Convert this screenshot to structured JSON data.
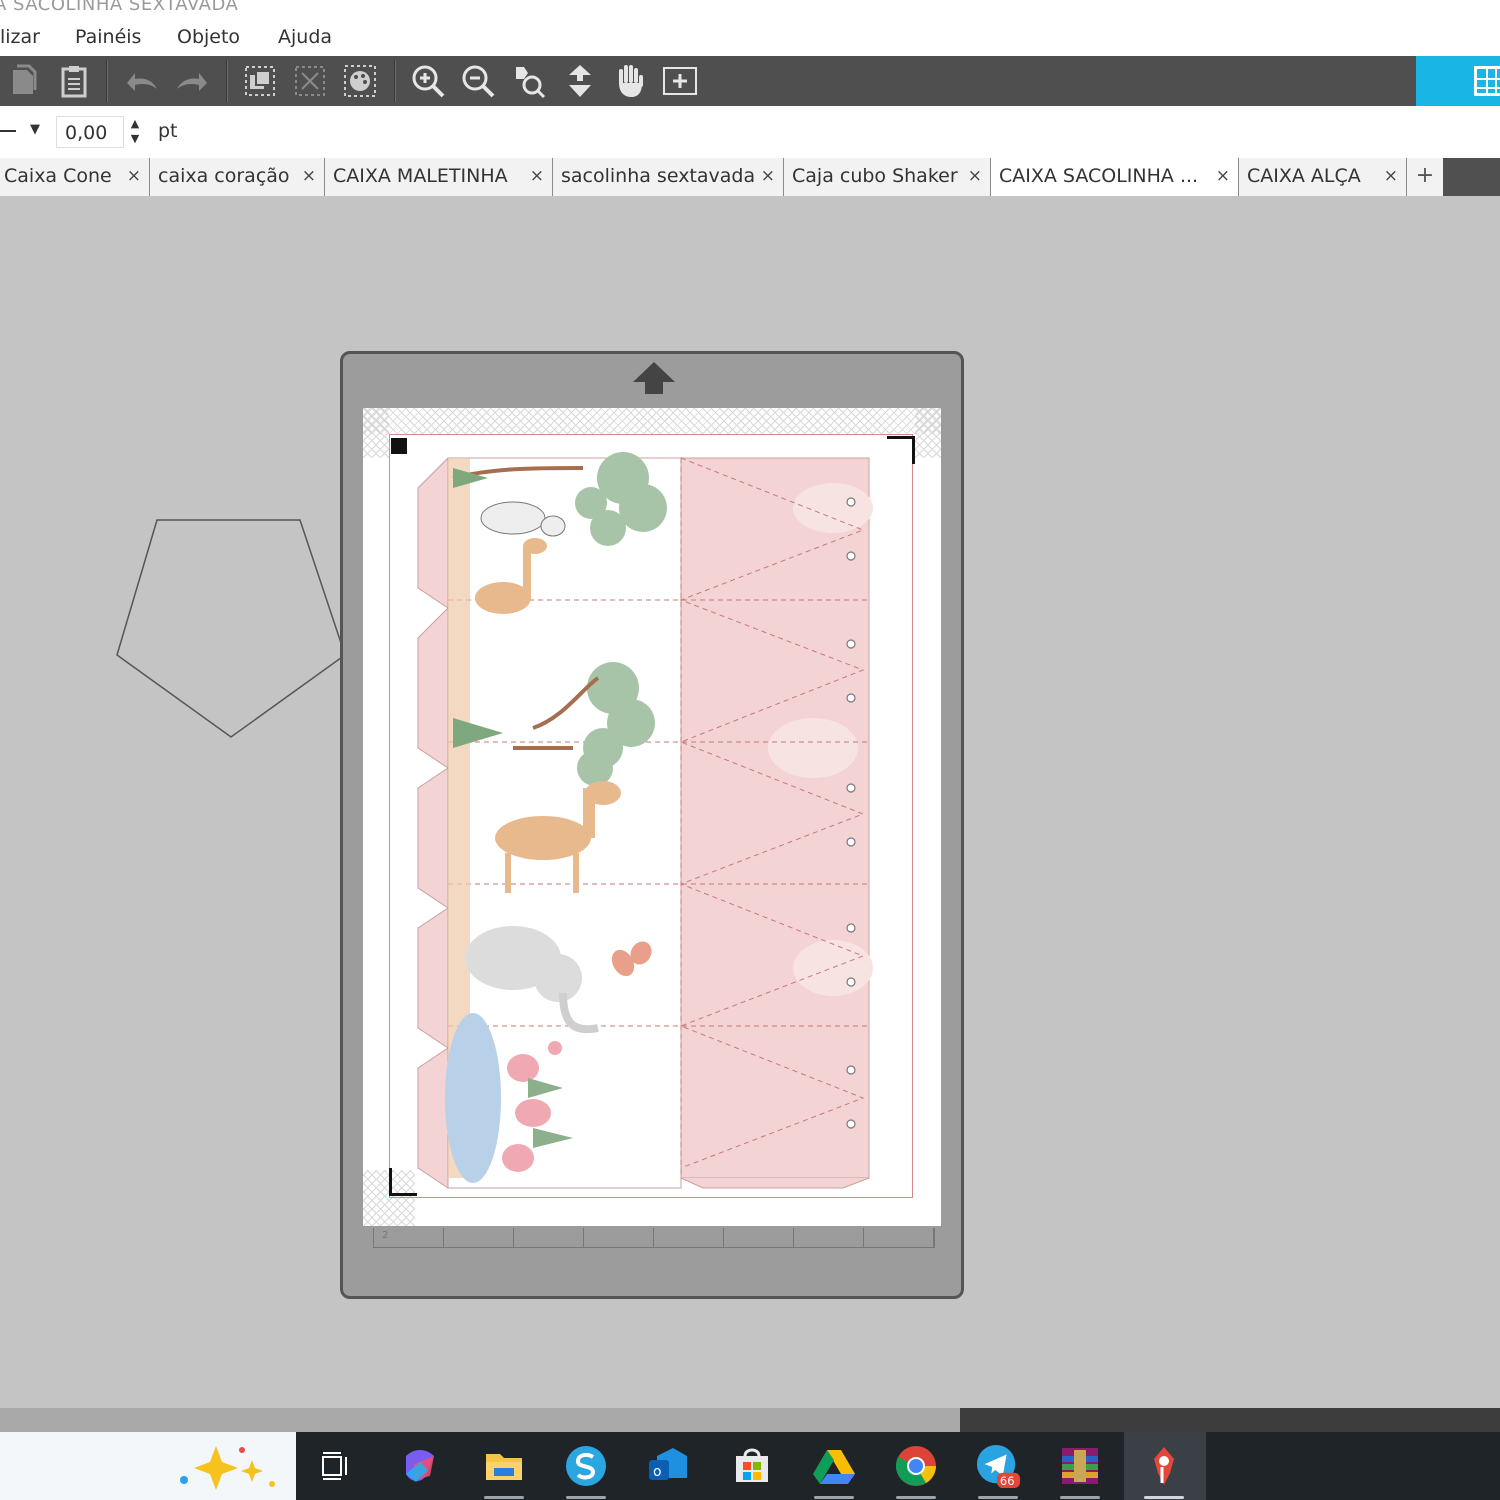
{
  "window": {
    "title": "A SACOLINHA SEXTAVADA"
  },
  "menu": {
    "items": [
      "lizar",
      "Painéis",
      "Objeto",
      "Ajuda"
    ]
  },
  "toolbar": {
    "icons": [
      "page-icon",
      "clipboard-icon",
      "undo-icon",
      "redo-icon",
      "group-icon",
      "ungroup-icon",
      "palette-icon",
      "zoom-in-icon",
      "zoom-out-icon",
      "zoom-fit-icon",
      "move-down-icon",
      "hand-icon",
      "add-page-icon",
      "grid-view-icon"
    ],
    "accent_color": "#19b5e3"
  },
  "properties": {
    "line_width_value": "0,00",
    "unit": "pt"
  },
  "tabs": [
    {
      "label": "Caixa Cone",
      "close": "×"
    },
    {
      "label": "caixa coração",
      "close": "×"
    },
    {
      "label": "CAIXA MALETINHA",
      "close": "×"
    },
    {
      "label": "sacolinha sextavada",
      "close": "×"
    },
    {
      "label": "Caja cubo Shaker",
      "close": "×"
    },
    {
      "label": "CAIXA SACOLINHA ...",
      "close": "×",
      "active": true
    },
    {
      "label": "CAIXA ALÇA",
      "close": "×"
    }
  ],
  "tab_add": "+",
  "canvas": {
    "background": "#c4c4c4",
    "mat_color": "#9c9c9c",
    "design_colors": {
      "pink": "#f3d3d4",
      "cut_line": "#d48a8a",
      "green": "#a8c4a8",
      "water": "#b8d0e8"
    },
    "ruler_mark": "2"
  },
  "taskbar": {
    "icons": [
      "copilot-sparkle-icon",
      "task-view-icon",
      "microsoft-365-icon",
      "file-explorer-icon",
      "silhouette-studio-icon",
      "outlook-icon",
      "microsoft-store-icon",
      "google-drive-icon",
      "chrome-icon",
      "telegram-icon",
      "winrar-icon",
      "cutting-app-icon"
    ],
    "telegram_badge": "66"
  }
}
